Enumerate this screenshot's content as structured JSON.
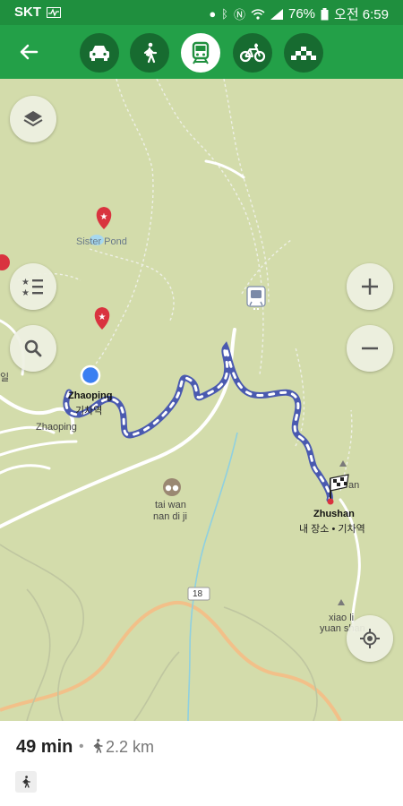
{
  "status_bar": {
    "carrier": "SKT",
    "battery": "76%",
    "time": "오전 6:59"
  },
  "toolbar": {
    "back_icon": "arrow-left-icon",
    "modes": [
      {
        "icon": "car-icon",
        "active": false
      },
      {
        "icon": "walk-icon",
        "active": false
      },
      {
        "icon": "train-icon",
        "active": true
      },
      {
        "icon": "bicycle-icon",
        "active": false
      },
      {
        "icon": "taxi-icon",
        "active": false
      }
    ]
  },
  "map": {
    "labels": {
      "sister_pond": "Sister Pond",
      "zhaoping_station_en": "Zhaoping",
      "zhaoping_station_ko": "기차역",
      "zhaoping_area": "Zhaoping",
      "tai_wan_1": "tai wan",
      "tai_wan_2": "nan di ji",
      "zhushan_en": "Zhushan",
      "zhushan_ko": "내 장소 • 기차역",
      "xiao_li_1": "xiao li",
      "xiao_li_2": "yuan shan",
      "zhushan_partial": "an",
      "road_number": "18",
      "left_edge": "일"
    },
    "controls": [
      "layers-icon",
      "saved-places-icon",
      "search-icon",
      "zoom-in-icon",
      "zoom-out-icon",
      "my-location-icon"
    ],
    "colors": {
      "route": "#4a5ab0",
      "highway": "#f2c089",
      "pin": "#d9333f"
    }
  },
  "trip": {
    "duration": "49 min",
    "separator": "•",
    "distance": "2.2 km"
  }
}
